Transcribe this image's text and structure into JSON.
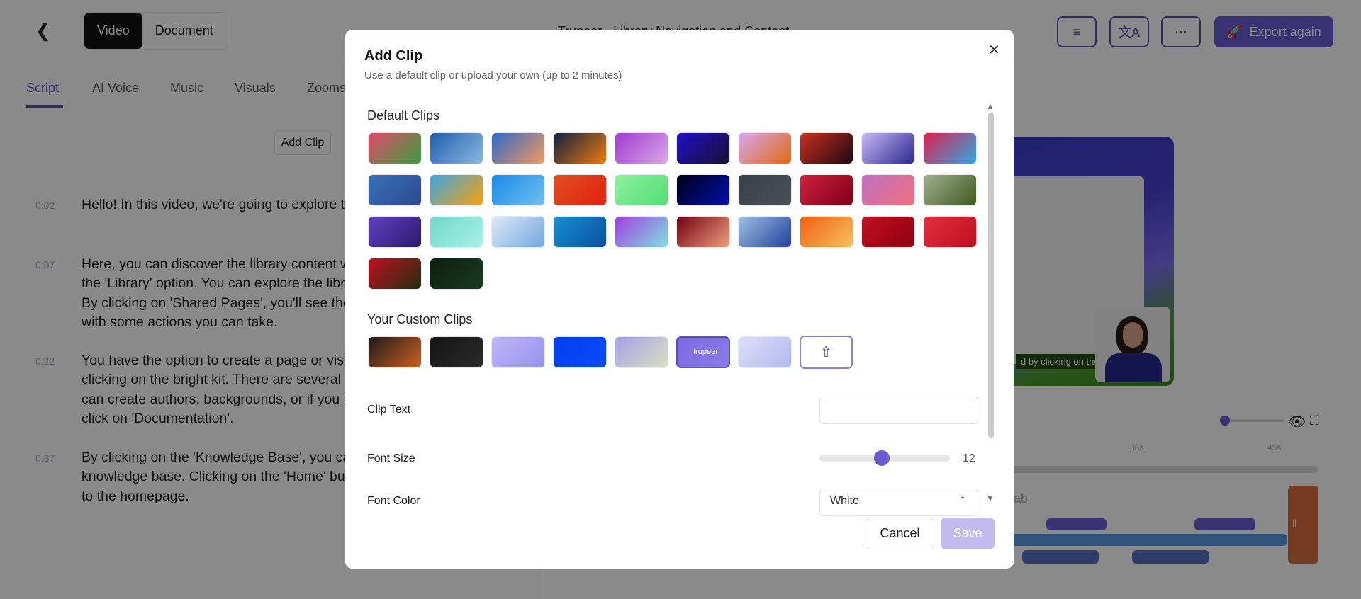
{
  "header": {
    "back_icon": "chevron-left-icon",
    "toggle": [
      "Video",
      "Document"
    ],
    "title": "Trupeer - Library Navigation and Content",
    "export_label": "Export again",
    "icon_buttons": [
      "sliders-icon",
      "translate-icon",
      "more-icon"
    ]
  },
  "tabs": [
    "Script",
    "AI Voice",
    "Music",
    "Visuals",
    "Zooms"
  ],
  "add_clip_label": "Add Clip",
  "script": [
    {
      "time": "0:02",
      "lines": [
        "Hello! In this video, we're going to explore the"
      ]
    },
    {
      "time": "0:07",
      "lines": [
        "Here, you can discover the library content we",
        "the 'Library' option. You can explore the librar",
        "By clicking on 'Shared Pages', you'll see the p",
        "with some actions you can take."
      ]
    },
    {
      "time": "0:22",
      "lines": [
        "You have the option to create a page or visit a",
        "clicking on the bright kit. There are several op",
        "can create authors, backgrounds, or if you ne",
        "click on 'Documentation'."
      ]
    },
    {
      "time": "0:37",
      "lines": [
        "By clicking on the 'Knowledge Base', you can",
        "knowledge base. Clicking on the 'Home' butto",
        "to the homepage."
      ]
    }
  ],
  "preview": {
    "caption": "d by clicking on the"
  },
  "timeline": {
    "ticks": [
      "36s",
      "45s"
    ],
    "track_label": "ab",
    "zoom_fraction": 0
  },
  "modal": {
    "title": "Add Clip",
    "subtitle": "Use a default clip or upload your own (up to 2 minutes)",
    "default_title": "Default Clips",
    "default_clips": [
      [
        "#e0486a",
        "#3aa040"
      ],
      [
        "#1d5fae",
        "#8fb8e0"
      ],
      [
        "#2d6ac8",
        "#f29a5e"
      ],
      [
        "#0c2140",
        "#ee7a10"
      ],
      [
        "#a23ad0",
        "#d8a8e8"
      ],
      [
        "#2010c8",
        "#1a1030"
      ],
      [
        "#d8a8f0",
        "#e06a10"
      ],
      [
        "#c83020",
        "#200810"
      ],
      [
        "#c8b8f8",
        "#2a2890"
      ],
      [
        "#e02050",
        "#30a8e0"
      ],
      [
        "#3a70b8",
        "#2a4a90"
      ],
      [
        "#3aa8e0",
        "#f8a010"
      ],
      [
        "#1a8ae8",
        "#70c0f0"
      ],
      [
        "#e05020",
        "#e02010"
      ],
      [
        "#90f0a0",
        "#50e070"
      ],
      [
        "#000010",
        "#0010b0"
      ],
      [
        "#3a4048",
        "#4a5058"
      ],
      [
        "#d02040",
        "#800010"
      ],
      [
        "#c070c0",
        "#f07080"
      ],
      [
        "#a0b090",
        "#405a20"
      ],
      [
        "#6040c0",
        "#2a1a70"
      ],
      [
        "#70d8c8",
        "#a8f0e8"
      ],
      [
        "#e0e8f8",
        "#70a8e0"
      ],
      [
        "#1890d0",
        "#0850a0"
      ],
      [
        "#a040e0",
        "#80e0e0"
      ],
      [
        "#700010",
        "#f0a080"
      ],
      [
        "#a0c0e0",
        "#2040a0"
      ],
      [
        "#f06010",
        "#f8c060"
      ],
      [
        "#c01020",
        "#900010"
      ],
      [
        "#e03040",
        "#c01020"
      ],
      [
        "#c01020",
        "#203010"
      ],
      [
        "#0a2010",
        "#1a3a20"
      ]
    ],
    "custom_title": "Your Custom Clips",
    "custom_clips": [
      [
        "#1a1a1a",
        "#d06020"
      ],
      [
        "#151515",
        "#2a2a2a"
      ],
      [
        "#c0b8f8",
        "#9890f0"
      ],
      [
        "#0040f0",
        "#0a4af8"
      ],
      [
        "#a8a0e8",
        "#d8e0c0"
      ],
      [
        "#7a6ae0",
        "#8a7cea"
      ],
      [
        "#e0e0f8",
        "#b0b8f0"
      ]
    ],
    "selected_custom_label": "trupeer",
    "upload_icon": "upload-icon",
    "clip_text_label": "Clip Text",
    "clip_text_value": "",
    "clip_text_placeholder": "",
    "font_size_label": "Font Size",
    "font_size_value": "12",
    "font_size_fraction": 0.48,
    "font_color_label": "Font Color",
    "font_color_value": "White",
    "cancel_label": "Cancel",
    "save_label": "Save"
  },
  "colors": {
    "accent": "#6b5bd2"
  }
}
